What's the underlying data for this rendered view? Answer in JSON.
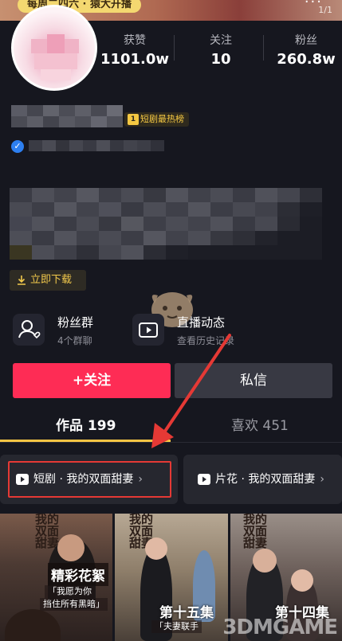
{
  "banner": {
    "pill": "每周二四六 · 猿大开播",
    "more": "···",
    "page": "1/1"
  },
  "stats": [
    {
      "label": "获赞",
      "value": "1101.0w"
    },
    {
      "label": "关注",
      "value": "10"
    },
    {
      "label": "粉丝",
      "value": "260.8w"
    }
  ],
  "profile": {
    "rank_badge": "短剧最热榜",
    "rank_num": "1"
  },
  "download_chip": "立即下载",
  "cards": [
    {
      "title": "粉丝群",
      "sub": "4个群聊",
      "icon": "fans-group-icon"
    },
    {
      "title": "直播动态",
      "sub": "查看历史记录",
      "icon": "live-replay-icon"
    }
  ],
  "actions": {
    "follow": "+关注",
    "message": "私信"
  },
  "tabs": [
    {
      "label": "作品 199",
      "active": true
    },
    {
      "label": "喜欢 451",
      "active": false
    }
  ],
  "collections": [
    {
      "label": "短剧 · 我的双面甜妻"
    },
    {
      "label": "片花 · 我的双面甜妻"
    }
  ],
  "thumbnails": [
    {
      "series": "我的双面甜妻",
      "caption": "精彩花絮",
      "quote1": "「我愿为你",
      "quote2": "挡住所有黑暗」"
    },
    {
      "series": "我的双面甜妻",
      "caption": "第十五集",
      "quote1": "「夫妻联手",
      "quote2": ""
    },
    {
      "series": "我的双面甜妻",
      "caption": "第十四集",
      "quote1": "",
      "quote2": ""
    }
  ],
  "watermark": "3DMGAME",
  "colors": {
    "accent_red": "#fe2c55",
    "gold": "#f6c544",
    "annotation_red": "#e53935"
  }
}
